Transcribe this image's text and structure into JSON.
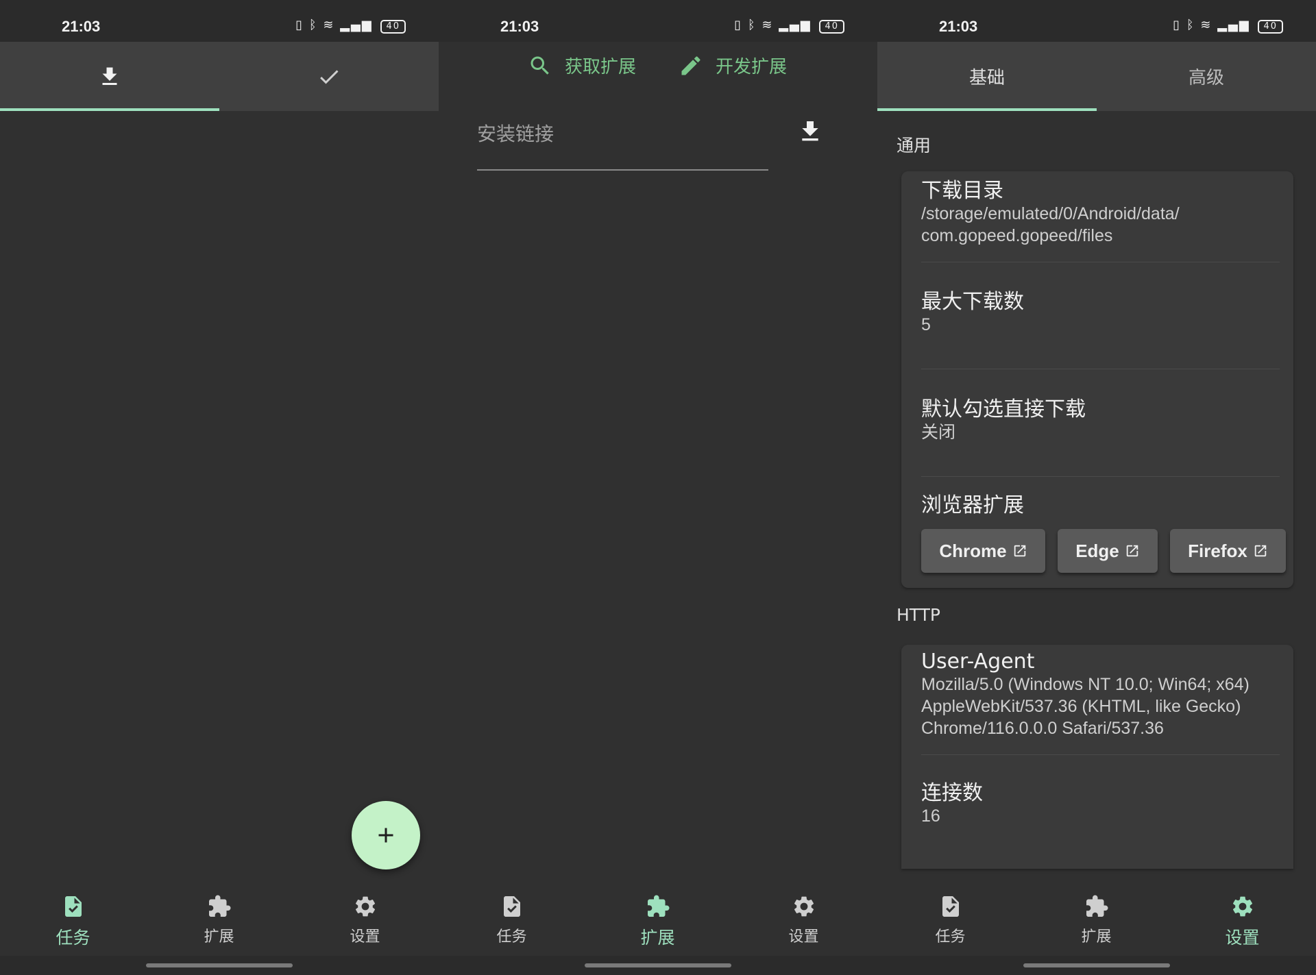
{
  "colors": {
    "accent": "#9ee0be",
    "fab": "#c4f2c8",
    "action_green": "#7ac68a",
    "background": "#303030"
  },
  "status_bar": {
    "time": "21:03",
    "battery": "40",
    "icons": [
      "vibrate-icon",
      "bluetooth-icon",
      "speed-icon",
      "hd-icon",
      "wifi-icon",
      "signal-5g-icon",
      "battery-icon"
    ]
  },
  "bottom_nav": [
    {
      "label": "任务",
      "icon": "task-icon"
    },
    {
      "label": "扩展",
      "icon": "puzzle-icon"
    },
    {
      "label": "设置",
      "icon": "gear-icon"
    }
  ],
  "tasks_screen": {
    "tabs": [
      {
        "icon": "download-icon",
        "active": true
      },
      {
        "icon": "check-icon",
        "active": false
      }
    ],
    "fab_icon": "plus-icon"
  },
  "extensions_screen": {
    "actions": [
      {
        "label": "获取扩展",
        "icon": "search-icon"
      },
      {
        "label": "开发扩展",
        "icon": "edit-icon"
      }
    ],
    "install_placeholder": "安装链接"
  },
  "settings_screen": {
    "tabs": [
      {
        "label": "基础",
        "active": true
      },
      {
        "label": "高级",
        "active": false
      }
    ],
    "sections": [
      {
        "title": "通用",
        "items": [
          {
            "title": "下载目录",
            "value_lines": [
              "/storage/emulated/0/Android/data/",
              "com.gopeed.gopeed/files"
            ]
          },
          {
            "title": "最大下载数",
            "value": "5"
          },
          {
            "title": "默认勾选直接下载",
            "value": "关闭"
          },
          {
            "title": "浏览器扩展",
            "buttons": [
              "Chrome",
              "Edge",
              "Firefox"
            ]
          }
        ]
      },
      {
        "title": "HTTP",
        "items": [
          {
            "title": "User-Agent",
            "value_lines": [
              "Mozilla/5.0 (Windows NT 10.0; Win64; x64)",
              "AppleWebKit/537.36 (KHTML, like Gecko)",
              "Chrome/116.0.0.0 Safari/537.36"
            ]
          },
          {
            "title": "连接数",
            "value": "16"
          }
        ]
      }
    ]
  }
}
